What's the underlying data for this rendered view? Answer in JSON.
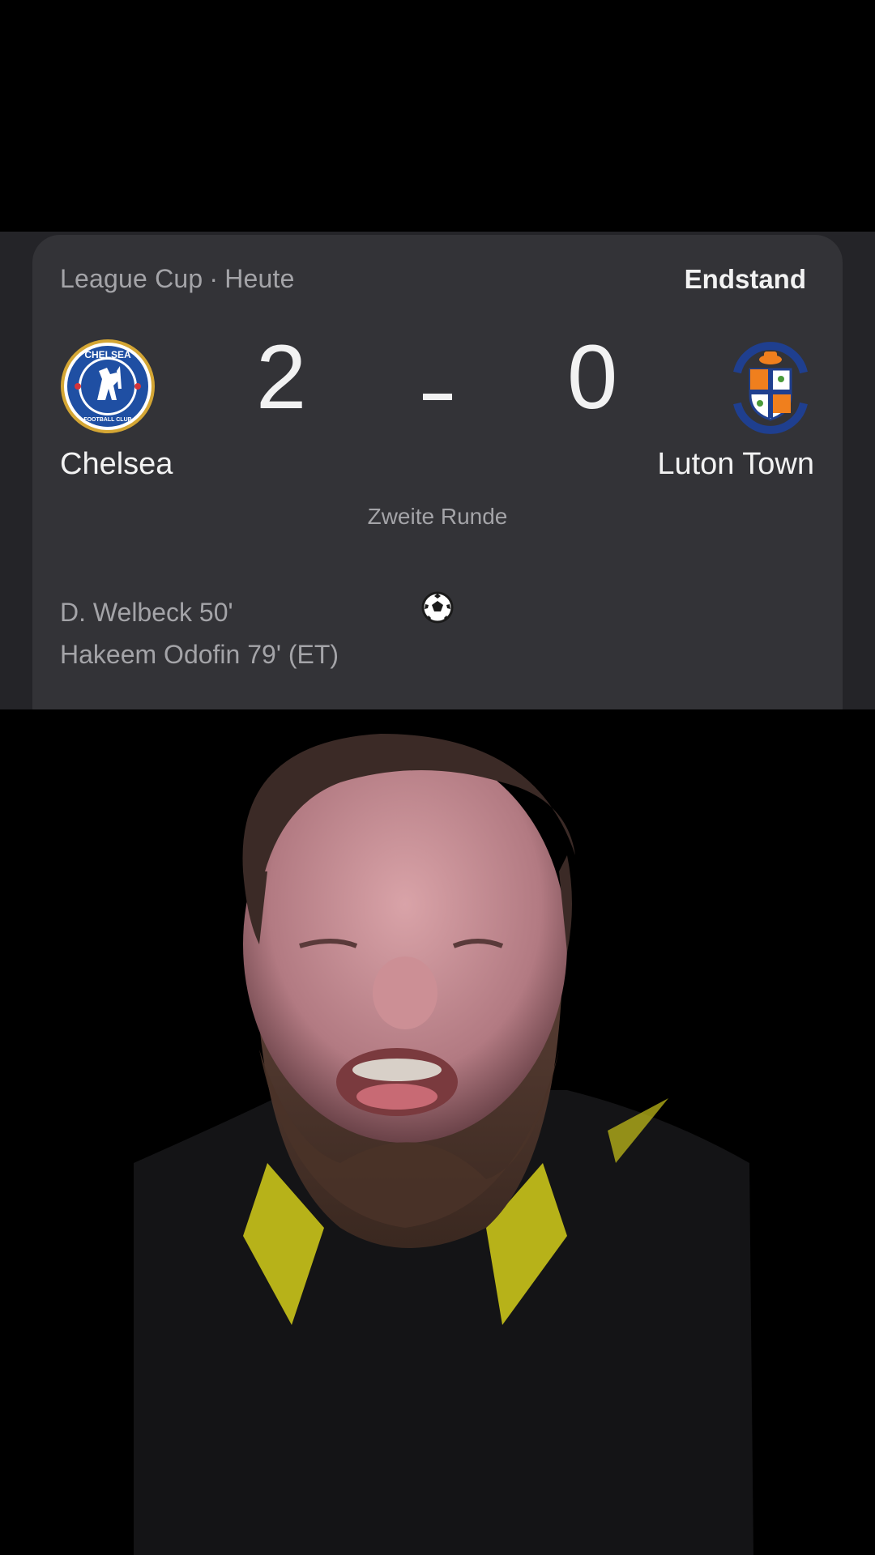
{
  "match": {
    "competition": "League Cup",
    "separator": "·",
    "date": "Heute",
    "status": "Endstand",
    "home": {
      "name": "Chelsea",
      "score": "2",
      "crest_icon": "chelsea-crest-icon",
      "crest_color": "#1f4fa3"
    },
    "away": {
      "name": "Luton Town",
      "score": "0",
      "crest_icon": "luton-crest-icon",
      "crest_color": "#f07f1d"
    },
    "round": "Zweite Runde",
    "goals": [
      "D. Welbeck 50'",
      "Hakeem Odofin 79' (ET)"
    ],
    "goal_icon": "soccer-ball-icon"
  },
  "colors": {
    "card_bg": "#333337",
    "band_bg": "#242428",
    "primary_text": "#f2f2f2",
    "secondary_text": "#a4a4a8",
    "shirt_accent": "#e6e01e"
  },
  "webcam": {
    "content": "person-webcam-overlay"
  }
}
